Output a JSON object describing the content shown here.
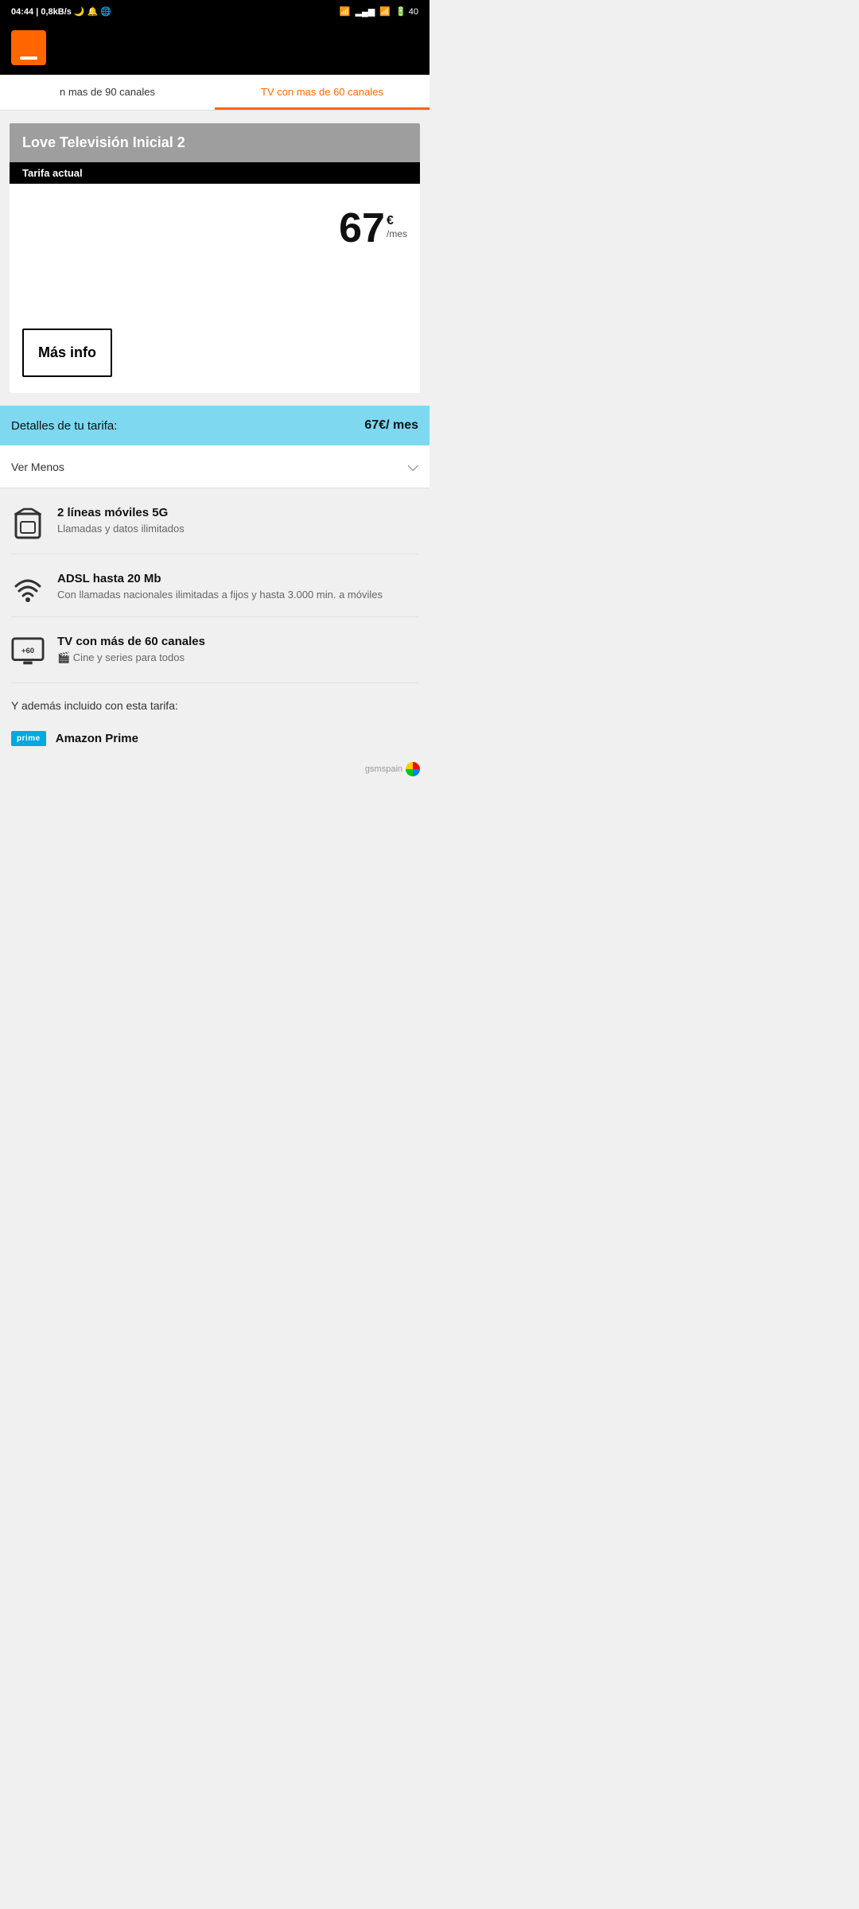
{
  "statusBar": {
    "time": "04:44",
    "network": "0,8kB/s",
    "battery": "40"
  },
  "tabs": [
    {
      "id": "tab-90",
      "label": "n mas de 90 canales",
      "active": false
    },
    {
      "id": "tab-60",
      "label": "TV con mas de 60 canales",
      "active": true
    }
  ],
  "plan": {
    "title": "Love Televisión Inicial 2",
    "badge": "Tarifa actual",
    "price": "67",
    "priceCurrency": "€",
    "pricePeriod": "/mes",
    "masInfoLabel": "Más info"
  },
  "details": {
    "label": "Detalles de tu tarifa:",
    "price": "67€/ mes",
    "verMenosLabel": "Ver Menos"
  },
  "features": [
    {
      "iconType": "sim",
      "title": "2 líneas móviles 5G",
      "desc": "Llamadas y datos ilimitados"
    },
    {
      "iconType": "wifi",
      "title": "ADSL hasta 20 Mb",
      "desc": "Con llamadas nacionales ilimitadas a fijos y hasta 3.000 min. a móviles"
    },
    {
      "iconType": "tv",
      "title": "TV con más de 60 canales",
      "desc": "🎬 Cine y series para todos"
    }
  ],
  "alsoIncluded": {
    "label": "Y además incluido con esta tarifa:"
  },
  "amazonPrime": {
    "badge": "prime",
    "label": "Amazon Prime"
  },
  "watermark": "gsmspain"
}
